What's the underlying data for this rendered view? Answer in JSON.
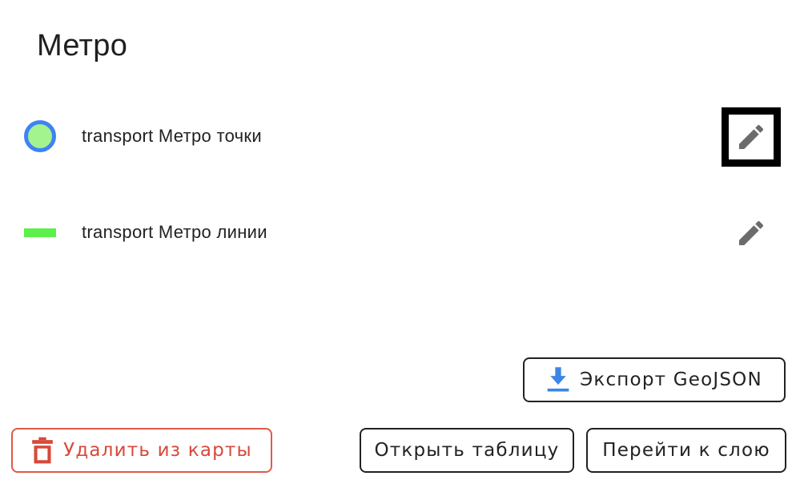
{
  "title": "Метро",
  "layers": [
    {
      "name": "transport Метро точки",
      "legend": "point",
      "fill": "#a3f38f",
      "stroke": "#3f82f6",
      "edit_icon": "pencil-icon",
      "focused": true
    },
    {
      "name": "transport Метро линии",
      "legend": "line",
      "stroke": "#5ef04a",
      "edit_icon": "pencil-icon",
      "focused": false
    }
  ],
  "buttons": {
    "export_label": "Экспорт GeoJSON",
    "export_icon": "download-icon",
    "delete_label": "Удалить из карты",
    "delete_icon": "trash-icon",
    "open_table_label": "Открыть таблицу",
    "goto_layer_label": "Перейти к слою"
  },
  "colors": {
    "danger": "#d8483a",
    "export_icon": "#3b86e6",
    "icon_gray": "#6b6b6b"
  }
}
